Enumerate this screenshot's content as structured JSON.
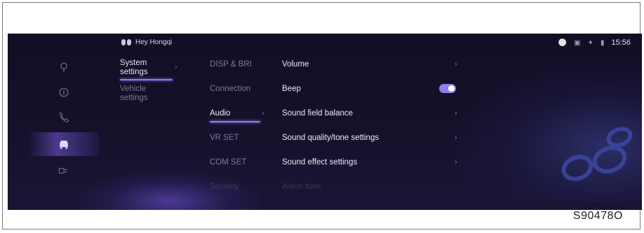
{
  "status": {
    "wake_word": "Hey Hongqi",
    "time": "15:56",
    "icons": [
      "mic-icon",
      "lock-icon",
      "bluetooth-icon",
      "signal-icon"
    ]
  },
  "nav": {
    "items": [
      {
        "icon": "navigation-icon"
      },
      {
        "icon": "music-icon"
      },
      {
        "icon": "phone-icon"
      },
      {
        "icon": "car-icon",
        "active": true
      },
      {
        "icon": "apps-icon"
      }
    ]
  },
  "menu": {
    "system": "System settings",
    "vehicle": "Vehicle settings"
  },
  "submenu": {
    "items": [
      {
        "label": "DISP & BRI"
      },
      {
        "label": "Connection"
      },
      {
        "label": "Audio",
        "active": true
      },
      {
        "label": "VR SET"
      },
      {
        "label": "COM SET"
      },
      {
        "label": "Security"
      }
    ]
  },
  "audio": {
    "items": [
      {
        "label": "Volume"
      },
      {
        "label": "Beep"
      },
      {
        "label": "Sound field balance"
      },
      {
        "label": "Sound quality/tone settings"
      },
      {
        "label": "Sound effect settings"
      },
      {
        "label": "Alarm tone"
      }
    ],
    "beep_on": true
  },
  "figure_code": "S90478O",
  "colors": {
    "accent": "#8c7cf0",
    "background": "#15112b"
  }
}
